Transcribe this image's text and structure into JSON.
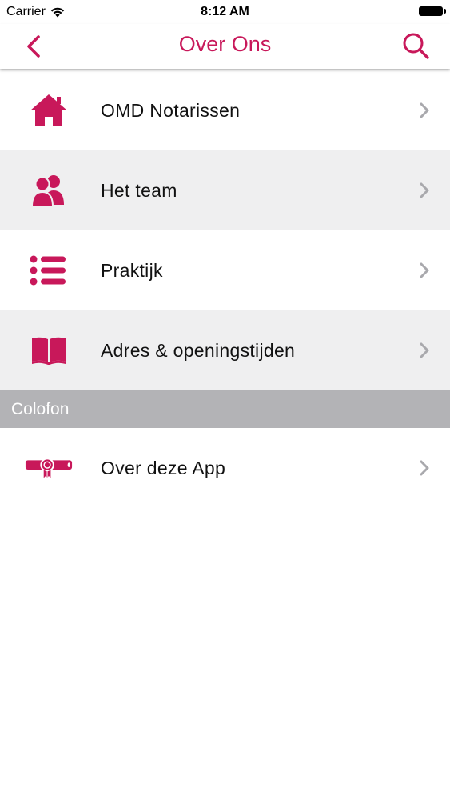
{
  "status_bar": {
    "carrier": "Carrier",
    "time": "8:12 AM"
  },
  "nav": {
    "title": "Over Ons"
  },
  "colors": {
    "accent": "#c8185a",
    "section_bg": "#b3b3b6",
    "alt_row_bg": "#efeff0",
    "chevron": "#a9a9ad"
  },
  "items": [
    {
      "label": "OMD Notarissen",
      "icon": "home-icon"
    },
    {
      "label": "Het team",
      "icon": "team-icon"
    },
    {
      "label": "Praktijk",
      "icon": "list-icon"
    },
    {
      "label": "Adres & openingstijden",
      "icon": "book-icon"
    }
  ],
  "section": {
    "title": "Colofon"
  },
  "colofon_items": [
    {
      "label": "Over deze App",
      "icon": "diploma-icon"
    }
  ]
}
